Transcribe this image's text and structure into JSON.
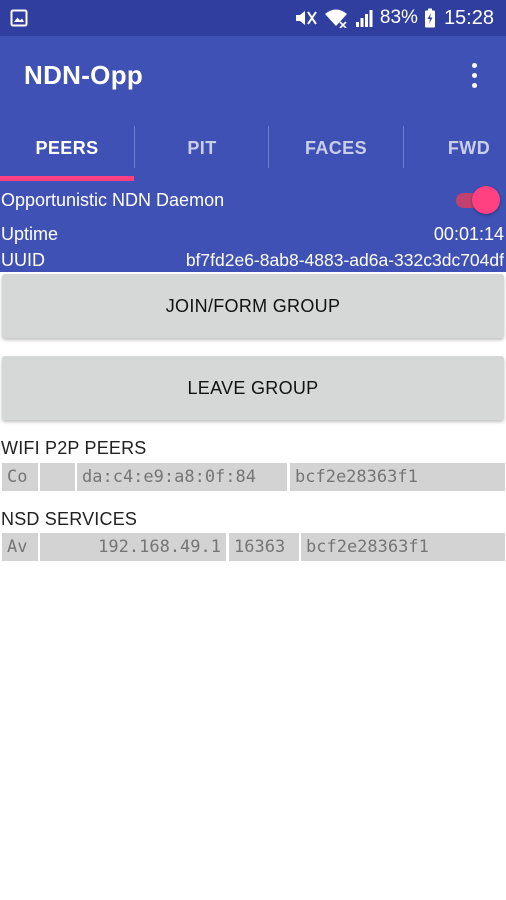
{
  "status_bar": {
    "battery_percent": "83%",
    "time": "15:28",
    "icons": [
      "gallery-icon",
      "mute-icon",
      "wifi-icon",
      "signal-icon",
      "battery-charging-icon"
    ]
  },
  "app_bar": {
    "title": "NDN-Opp",
    "menu_icon": "overflow-menu-icon"
  },
  "tabs": [
    {
      "label": "PEERS",
      "active": true
    },
    {
      "label": "PIT",
      "active": false
    },
    {
      "label": "FACES",
      "active": false
    },
    {
      "label": "FWD",
      "active": false
    }
  ],
  "daemon": {
    "label": "Opportunistic NDN Daemon",
    "enabled": true,
    "uptime_label": "Uptime",
    "uptime_value": "00:01:14",
    "uuid_label": "UUID",
    "uuid_value": "bf7fd2e6-8ab8-4883-ad6a-332c3dc704df"
  },
  "buttons": {
    "join": "JOIN/FORM GROUP",
    "leave": "LEAVE GROUP"
  },
  "wifi_peers": {
    "title": "WIFI P2P PEERS",
    "rows": [
      {
        "status": "Co",
        "blank": "",
        "mac": "da:c4:e9:a8:0f:84",
        "id": "bcf2e28363f1"
      }
    ]
  },
  "nsd_services": {
    "title": "NSD SERVICES",
    "rows": [
      {
        "status": "Av",
        "ip": "192.168.49.1",
        "port": "16363",
        "id": "bcf2e28363f1"
      }
    ]
  },
  "colors": {
    "primary": "#3F51B5",
    "primary_dark": "#303F9F",
    "accent": "#FF4081",
    "button_bg": "#D6D7D7",
    "cell_bg": "#D3D3D3"
  }
}
